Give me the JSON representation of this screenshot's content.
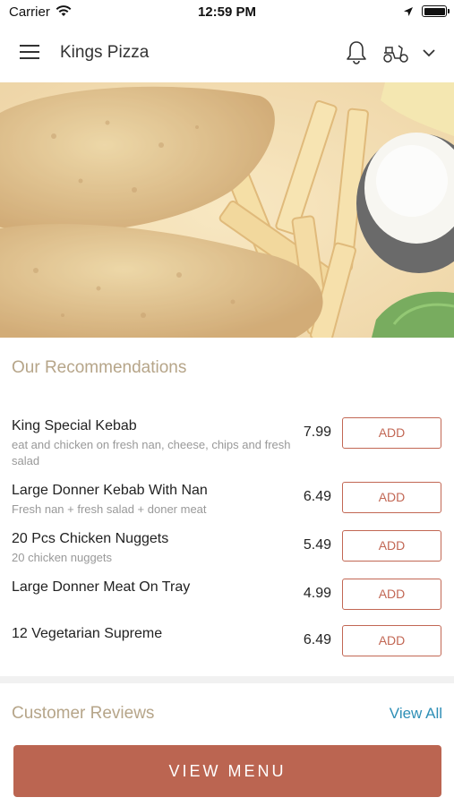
{
  "status_bar": {
    "carrier": "Carrier",
    "time": "12:59 PM"
  },
  "header": {
    "title": "Kings Pizza"
  },
  "icons": {
    "menu": "hamburger-menu-icon",
    "notifications": "bell-icon",
    "delivery": "scooter-icon",
    "dropdown": "chevron-down-icon"
  },
  "recommendations": {
    "title": "Our Recommendations",
    "items": [
      {
        "name": "King Special Kebab",
        "description": "eat and chicken on fresh nan, cheese, chips and fresh salad",
        "price": "7.99",
        "add_label": "ADD"
      },
      {
        "name": "Large Donner Kebab With Nan",
        "description": "Fresh nan + fresh salad + doner meat",
        "price": "6.49",
        "add_label": "ADD"
      },
      {
        "name": "20 Pcs Chicken Nuggets",
        "description": "20 chicken nuggets",
        "price": "5.49",
        "add_label": "ADD"
      },
      {
        "name": "Large Donner Meat On Tray",
        "description": "",
        "price": "4.99",
        "add_label": "ADD"
      },
      {
        "name": "12 Vegetarian Supreme",
        "description": "",
        "price": "6.49",
        "add_label": "ADD"
      }
    ]
  },
  "reviews": {
    "title": "Customer Reviews",
    "view_all_label": "View All"
  },
  "footer": {
    "view_menu_label": "VIEW MENU"
  },
  "colors": {
    "accent": "#bb6551",
    "section_title": "#b6a589",
    "link": "#2e8fb6"
  }
}
